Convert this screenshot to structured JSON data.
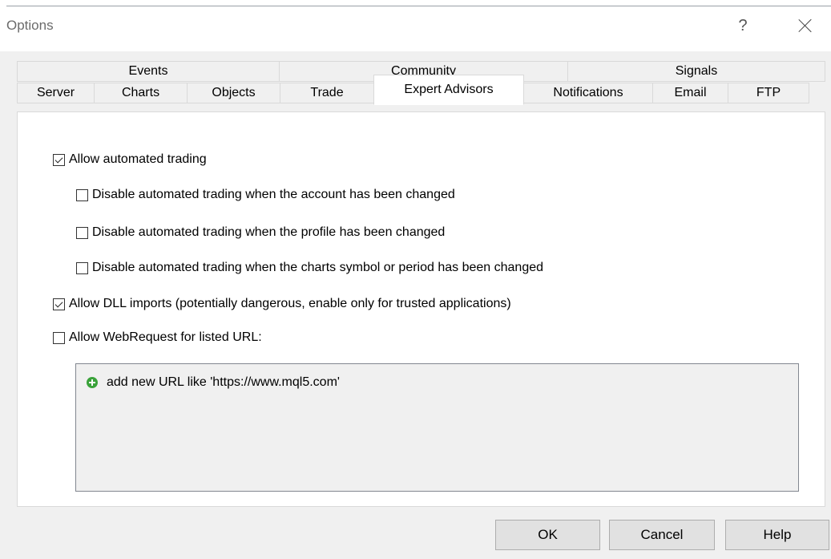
{
  "window": {
    "title": "Options",
    "help_glyph": "?"
  },
  "tabs": {
    "row1": [
      "Events",
      "Community",
      "Signals"
    ],
    "row2": [
      "Server",
      "Charts",
      "Objects",
      "Trade",
      "Expert Advisors",
      "Notifications",
      "Email",
      "FTP"
    ],
    "active": "Expert Advisors"
  },
  "options": {
    "allow_automated_trading": {
      "label": "Allow automated trading",
      "checked": true
    },
    "disable_on_account_change": {
      "label": "Disable automated trading when the account has been changed",
      "checked": false
    },
    "disable_on_profile_change": {
      "label": "Disable automated trading when the profile has been changed",
      "checked": false
    },
    "disable_on_symbol_change": {
      "label": "Disable automated trading when the charts symbol or period has been changed",
      "checked": false
    },
    "allow_dll_imports": {
      "label": "Allow DLL imports (potentially dangerous, enable only for trusted applications)",
      "checked": true
    },
    "allow_webrequest": {
      "label": "Allow WebRequest for listed URL:",
      "checked": false
    }
  },
  "url_list": {
    "add_label": "add new URL like 'https://www.mql5.com'"
  },
  "buttons": {
    "ok": "OK",
    "cancel": "Cancel",
    "help": "Help"
  }
}
